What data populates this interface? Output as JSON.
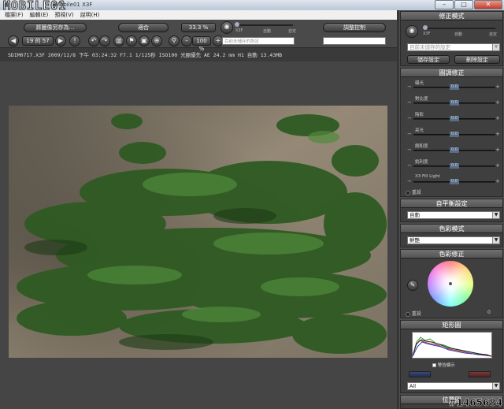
{
  "window": {
    "title": "Mobile01 X3F",
    "logo": "MOBILE01",
    "min": "–",
    "max": "□",
    "close": "✕"
  },
  "menu": [
    {
      "label": "檔案(F)"
    },
    {
      "label": "編輯(E)"
    },
    {
      "label": "預視(V)"
    },
    {
      "label": "說明(H)"
    }
  ],
  "toolbar": {
    "save_as": "將圖像另存為…",
    "fit": "適合",
    "nav_counter": "19 的 57",
    "zoom_primary": "33.3 %",
    "zoom_secondary": "100 %",
    "adjust_control": "調整控制",
    "mode_labels": [
      "X3F",
      "自動",
      "自定"
    ],
    "preset_placeholder": "目前未儲存的設定"
  },
  "info": {
    "text": "SDIM0717.X3F  2009/12/8 下午 03:24:32  F7.1  1/125秒  ISO100  光圈優先  AE 24.2 mm  H1  自動  13.43MB"
  },
  "panel": {
    "mode": {
      "title": "修正模式",
      "labels": [
        "X3F",
        "自動",
        "自定"
      ],
      "preset": "目前未儲存的設定",
      "save": "儲存設定",
      "delete": "刪除設定"
    },
    "tone": {
      "title": "圖調修正",
      "sliders": [
        {
          "label": "曝光",
          "value": "0.0"
        },
        {
          "label": "對比度",
          "value": "0.0"
        },
        {
          "label": "陰影",
          "value": "0.0"
        },
        {
          "label": "亮光",
          "value": "0.0"
        },
        {
          "label": "飽和度",
          "value": "0.0"
        },
        {
          "label": "銳利度",
          "value": "0.0"
        },
        {
          "label": "X3 Fill Light",
          "value": "0.0"
        }
      ],
      "reset": "重設"
    },
    "wb": {
      "title": "自平衡設定",
      "value": "自動"
    },
    "color_mode": {
      "title": "色彩模式",
      "value": "鮮艷"
    },
    "color_adjust": {
      "title": "色彩修正",
      "reset": "重設",
      "value": "0"
    },
    "histogram": {
      "title": "矩形圖",
      "checkbox": "警告顯示",
      "channel": "All"
    },
    "position": {
      "title": "位置圖"
    }
  },
  "watermark": "#1465684"
}
